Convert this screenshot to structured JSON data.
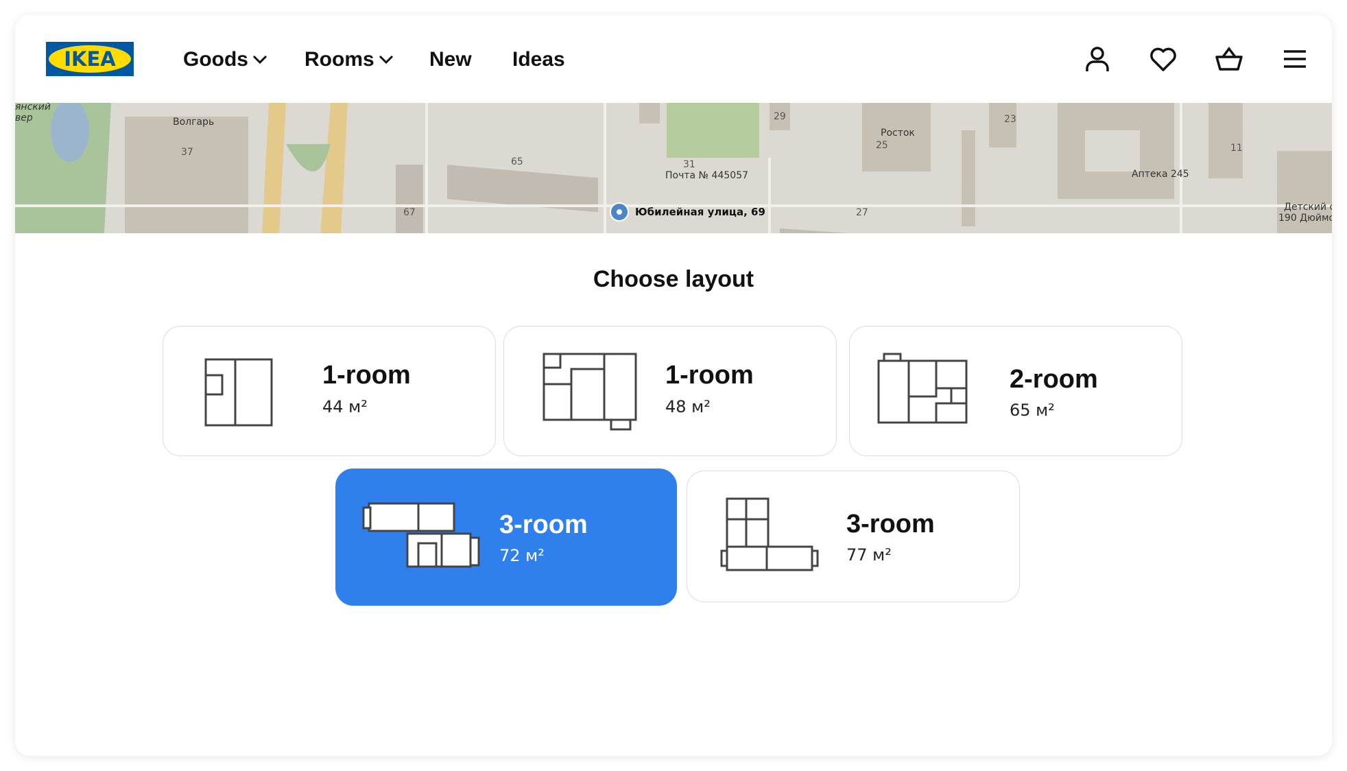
{
  "header": {
    "logo_text": "IKEA",
    "nav": [
      {
        "label": "Goods"
      },
      {
        "label": "Rooms"
      },
      {
        "label": "New"
      },
      {
        "label": "Ideas"
      }
    ],
    "icons": [
      "user-icon",
      "heart-icon",
      "basket-icon",
      "menu-icon"
    ]
  },
  "map": {
    "address": "Юбилейная улица, 69",
    "labels": {
      "park": "янский\nвер",
      "volgar": "Волгарь",
      "post": "Почта № 445057",
      "rostok": "Росток",
      "apteka": "Аптека 245",
      "detsky": "Детский с",
      "dyumo": "190 Дюймо"
    },
    "numbers": {
      "n37": "37",
      "n65": "65",
      "n67": "67",
      "n31": "31",
      "n29": "29",
      "n25": "25",
      "n27": "27",
      "n23": "23",
      "n11": "11"
    }
  },
  "main": {
    "title": "Choose layout",
    "layouts": [
      {
        "name": "1-room",
        "area": "44 м²",
        "selected": false
      },
      {
        "name": "1-room",
        "area": "48 м²",
        "selected": false
      },
      {
        "name": "2-room",
        "area": "65 м²",
        "selected": false
      },
      {
        "name": "3-room",
        "area": "72 м²",
        "selected": true
      },
      {
        "name": "3-room",
        "area": "77 м²",
        "selected": false
      }
    ]
  },
  "colors": {
    "accent": "#2f80ed",
    "logo_blue": "#0058a3",
    "logo_yellow": "#ffdb00"
  }
}
